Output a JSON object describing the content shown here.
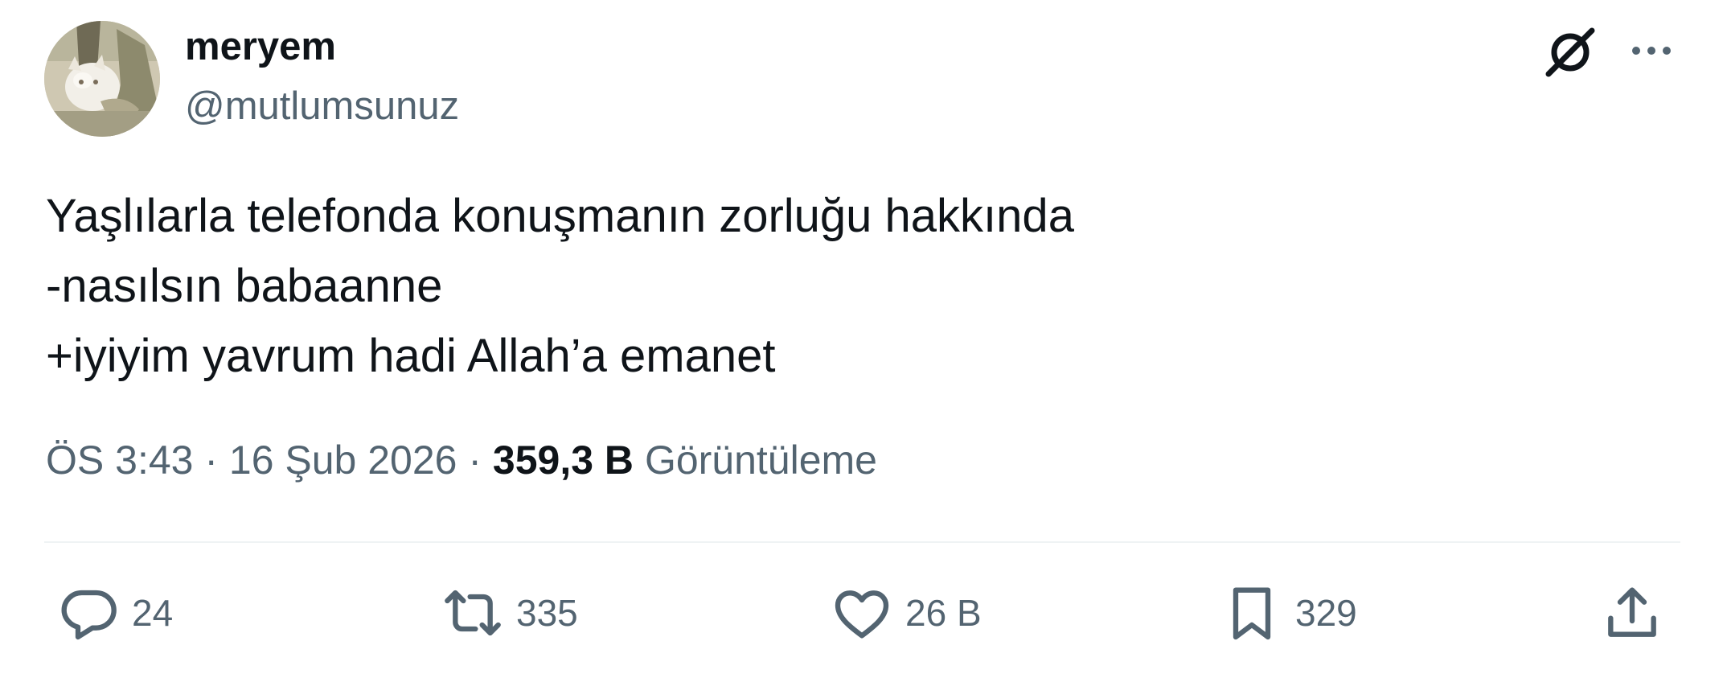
{
  "author": {
    "display_name": "meryem",
    "handle": "@mutlumsunuz",
    "avatar_icon": "cat-photo-avatar"
  },
  "header_icons": {
    "grok": "grok-icon",
    "more": "more-options-icon"
  },
  "tweet": {
    "lines": [
      "Yaşlılarla telefonda konuşmanın zorluğu hakkında",
      "-nasılsın babaanne",
      "+iyiyim yavrum hadi Allah’a emanet"
    ]
  },
  "meta": {
    "time": "ÖS 3:43",
    "separator": " · ",
    "date": "16 Şub 2026",
    "views_count": "359,3 B",
    "views_label": "Görüntüleme"
  },
  "actions": {
    "reply_count": "24",
    "retweet_count": "335",
    "like_count": "26 B",
    "bookmark_count": "329"
  },
  "colors": {
    "text_primary": "#0f1419",
    "text_secondary": "#536471",
    "divider": "#eff3f4"
  }
}
